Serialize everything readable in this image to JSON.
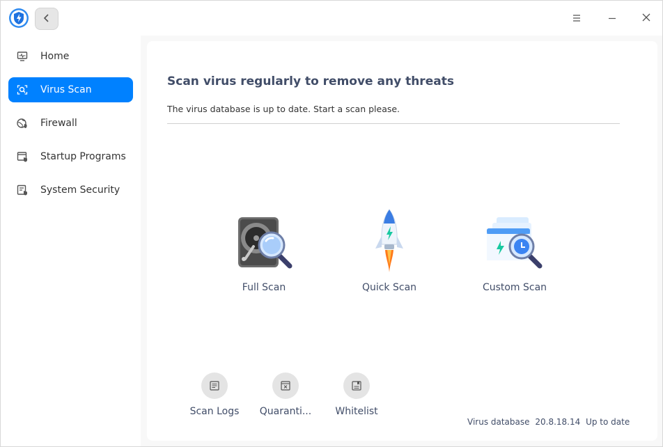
{
  "window": {
    "back_icon": "chevron-left-icon",
    "menu_icon": "hamburger-menu-icon",
    "minimize_icon": "minimize-icon",
    "close_icon": "close-icon",
    "app_icon": "shield-bolt-icon"
  },
  "sidebar": {
    "items": [
      {
        "label": "Home",
        "icon": "monitor-icon",
        "active": false
      },
      {
        "label": "Virus Scan",
        "icon": "scan-icon",
        "active": true
      },
      {
        "label": "Firewall",
        "icon": "globe-icon",
        "active": false
      },
      {
        "label": "Startup Programs",
        "icon": "startup-window-icon",
        "active": false
      },
      {
        "label": "System Security",
        "icon": "security-doc-icon",
        "active": false
      }
    ]
  },
  "main": {
    "title": "Scan virus regularly to remove any threats",
    "subtitle": "The virus database is up to date. Start a scan please.",
    "scan_options": [
      {
        "label": "Full Scan",
        "icon": "hard-drive-magnifier-icon"
      },
      {
        "label": "Quick Scan",
        "icon": "rocket-icon"
      },
      {
        "label": "Custom Scan",
        "icon": "folder-magnifier-icon"
      }
    ],
    "tools": [
      {
        "label": "Scan Logs",
        "icon": "log-list-icon"
      },
      {
        "label": "Quaranti...",
        "icon": "quarantine-box-icon"
      },
      {
        "label": "Whitelist",
        "icon": "whitelist-doc-icon"
      }
    ],
    "footer": {
      "db_label": "Virus database",
      "db_version": "20.8.18.14",
      "db_status": "Up to date"
    }
  },
  "colors": {
    "accent": "#0081ff",
    "text_dark": "#414d68"
  }
}
